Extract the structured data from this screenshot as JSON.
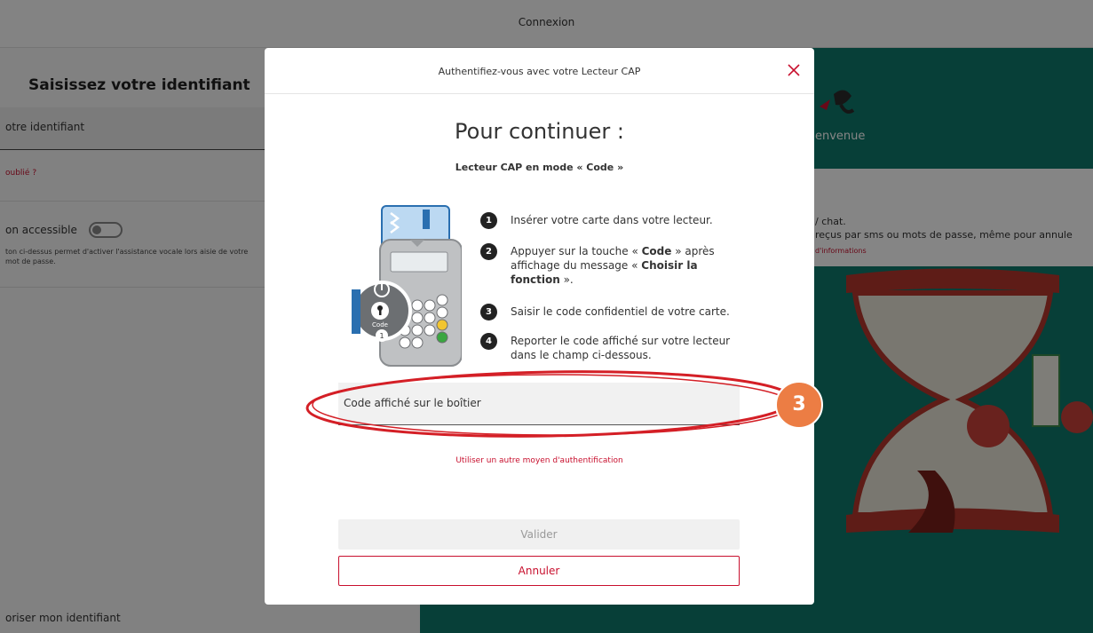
{
  "background": {
    "top_bar_title": "Connexion",
    "left": {
      "heading": "Saisissez votre identifiant",
      "identifier_field_label": "otre identifiant",
      "forgot_link": "oublié ?",
      "accessible_label": "on accessible",
      "accessible_description": "ton ci-dessus permet d'activer l'assistance vocale lors aisie de votre mot de passe.",
      "remember_label": "oriser mon identifiant"
    },
    "right": {
      "welcome": "envenue",
      "info_line1": "/ chat.",
      "info_line2": "reçus par sms ou mots de passe, même pour annule",
      "info_link": "d'informations"
    }
  },
  "modal": {
    "header_title": "Authentifiez-vous avec votre Lecteur CAP",
    "title": "Pour continuer :",
    "subtitle": "Lecteur CAP en mode « Code »",
    "steps": [
      {
        "num": "1",
        "text": "Insérer votre carte dans votre lecteur."
      },
      {
        "num": "2",
        "text_before": "Appuyer sur la touche « ",
        "bold1": "Code",
        "text_mid": " » après affichage du message « ",
        "bold2": "Choisir la fonction",
        "text_after": " »."
      },
      {
        "num": "3",
        "text": "Saisir le code confidentiel de votre carte."
      },
      {
        "num": "4",
        "text": "Reporter le code affiché sur votre lecteur dans le champ ci-dessous."
      }
    ],
    "code_field_placeholder": "Code affiché sur le boîtier",
    "other_auth_link": "Utiliser un autre moyen d'authentification",
    "validate_label": "Valider",
    "cancel_label": "Annuler",
    "reader_key_label": "Code",
    "reader_key_number": "1"
  },
  "annotation": {
    "badge_number": "3",
    "badge_color": "#ec7d44",
    "ellipse_color": "#d41f26"
  },
  "colors": {
    "accent": "#c8102e",
    "teal": "#0f7a6c"
  }
}
